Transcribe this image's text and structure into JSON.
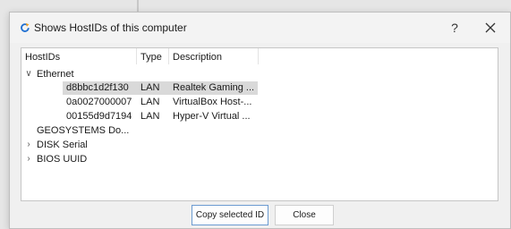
{
  "dialog": {
    "title": "Shows HostIDs of this computer",
    "help_label": "?",
    "title_icon": "refresh-icon",
    "close_icon": "close-icon"
  },
  "columns": {
    "hostids": "HostIDs",
    "type": "Type",
    "description": "Description"
  },
  "tree": {
    "ethernet": {
      "label": "Ethernet",
      "expanded": true,
      "children": [
        {
          "id": "d8bbc1d2f130",
          "type": "LAN",
          "description": "Realtek Gaming ...",
          "selected": true
        },
        {
          "id": "0a0027000007",
          "type": "LAN",
          "description": "VirtualBox Host-...",
          "selected": false
        },
        {
          "id": "00155d9d7194",
          "type": "LAN",
          "description": "Hyper-V Virtual ...",
          "selected": false
        }
      ]
    },
    "geosystems": {
      "label": "GEOSYSTEMS Do..."
    },
    "disk_serial": {
      "label": "DISK Serial",
      "expanded": false
    },
    "bios_uuid": {
      "label": "BIOS UUID",
      "expanded": false
    }
  },
  "buttons": {
    "copy_label": "Copy selected ID",
    "close_label": "Close"
  },
  "colors": {
    "selection": "#d9d9d9",
    "accent": "#6b9bd1",
    "icon": "#1f6fd1"
  }
}
